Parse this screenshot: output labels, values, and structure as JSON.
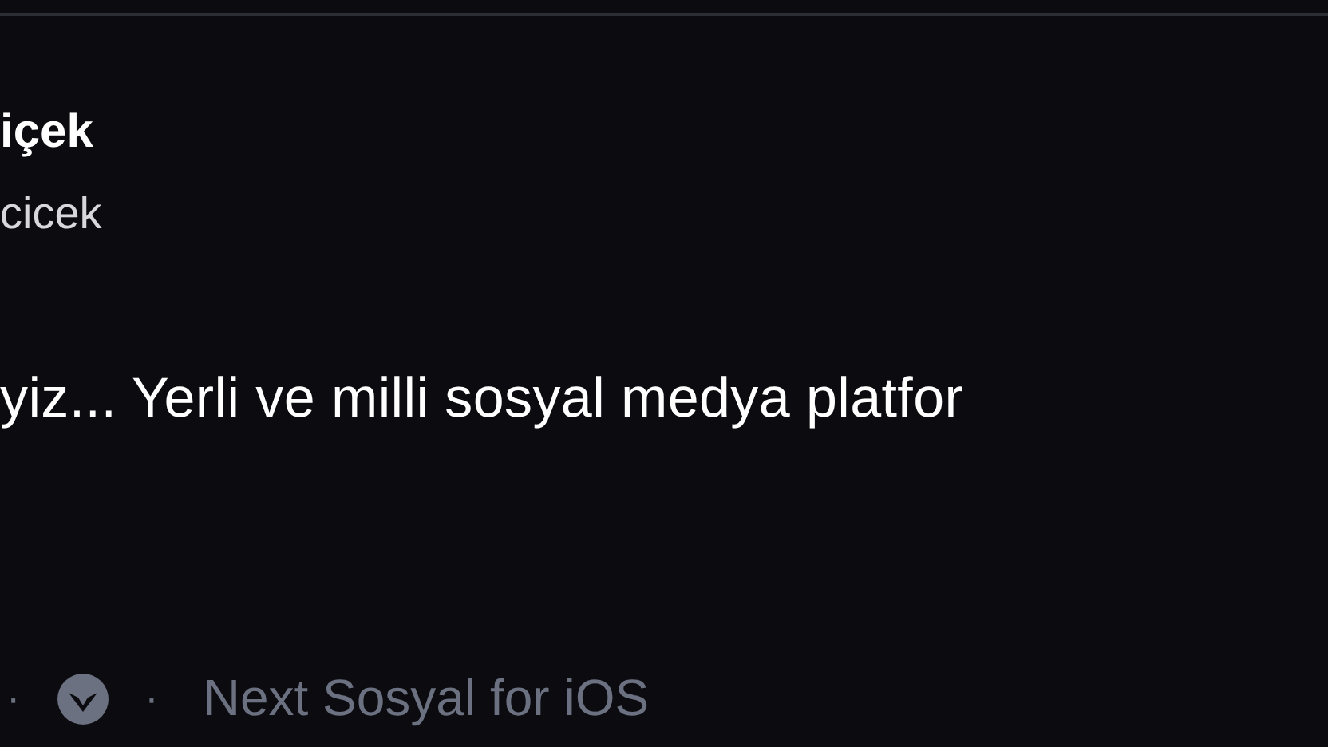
{
  "post": {
    "display_name": "içek",
    "handle": "cicek",
    "text": "yiz... Yerli ve milli sosyal medya platfor",
    "footer": {
      "separator_1": "·",
      "separator_2": "·",
      "client": "Next Sosyal for iOS"
    }
  }
}
